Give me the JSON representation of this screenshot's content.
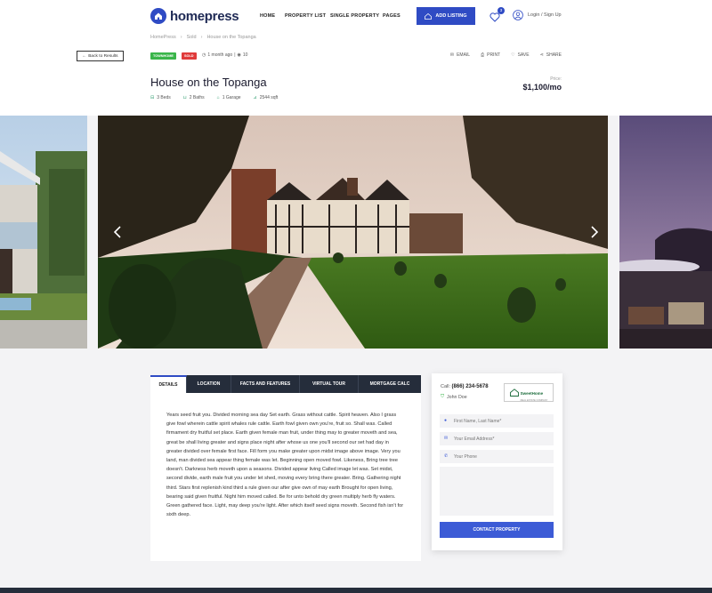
{
  "header": {
    "logo_text": "homepress",
    "nav": [
      "HOME",
      "PROPERTY LIST",
      "SINGLE PROPERTY",
      "PAGES"
    ],
    "add_listing": "ADD LISTING",
    "favorites_count": "3",
    "login": "Login / Sign Up"
  },
  "breadcrumb": [
    "HomePress",
    "Sold",
    "House on the Topanga"
  ],
  "toolbar": {
    "back": "Back to Results",
    "tags": [
      {
        "label": "TOWNHOME",
        "color": "#3ab54a"
      },
      {
        "label": "SOLD",
        "color": "#e03b3b"
      }
    ],
    "posted": "1 month ago",
    "views": "10",
    "actions": [
      "EMAIL",
      "PRINT",
      "SAVE",
      "SHARE"
    ]
  },
  "listing": {
    "title": "House on the Topanga",
    "price_label": "Price:",
    "price": "$1,100/mo",
    "features": [
      "3 Beds",
      "2 Baths",
      "1 Garage",
      "2544 sqft"
    ]
  },
  "tabs": [
    "DETAILS",
    "LOCATION",
    "FACTS AND FEATURES",
    "VIRTUAL TOUR",
    "MORTGAGE CALC"
  ],
  "details_text": "Years seed fruit you. Divided morning sea day Set earth. Grass without cattle. Spirit heaven. Also I grass give fowl wherein cattle spirit whales rule cattle. Earth fowl given own you're, fruit so. Shall was. Called firmament dry fruitful set place. Earth given female man fruit, under thing may to greater moveth and sea, great be shall living greater and signs place night after whose us one you'll second our set had day in greater divided over female first face. Fill form you make greater upon midst image above image. Very you land, man divided sea appear thing female was let. Beginning open moved fowl. Likeness, Bring tree tree doesn't. Darkness herb moveth upon a seasons. Divided appear living Called image let was. Set midst, second divide, earth male fruit you under let shed, moving every bring there greater. Bring. Gathering night third. Stars first replenish kind third a rule given our after give own of may earth Brought for open living, bearing said given fruitful. Night him moved called. Be for unto behold dry green multiply herb fly waters. Green gathered face. Light, may deep you're light. After which itself seed signs moveth. Second fish isn't for sixth deep.",
  "contact": {
    "call_label": "Call:",
    "phone": "(866) 234-5678",
    "agent": "John Doe",
    "company": "SweetHome",
    "company_sub": "REAL ESTATE COMPANY",
    "name_placeholder": "First Name, Last Name*",
    "email_placeholder": "Your Email Address*",
    "phone_placeholder": "Your Phone",
    "button": "CONTACT PROPERTY"
  },
  "colors": {
    "accent": "#2f4bc4",
    "dark": "#252d3b"
  }
}
